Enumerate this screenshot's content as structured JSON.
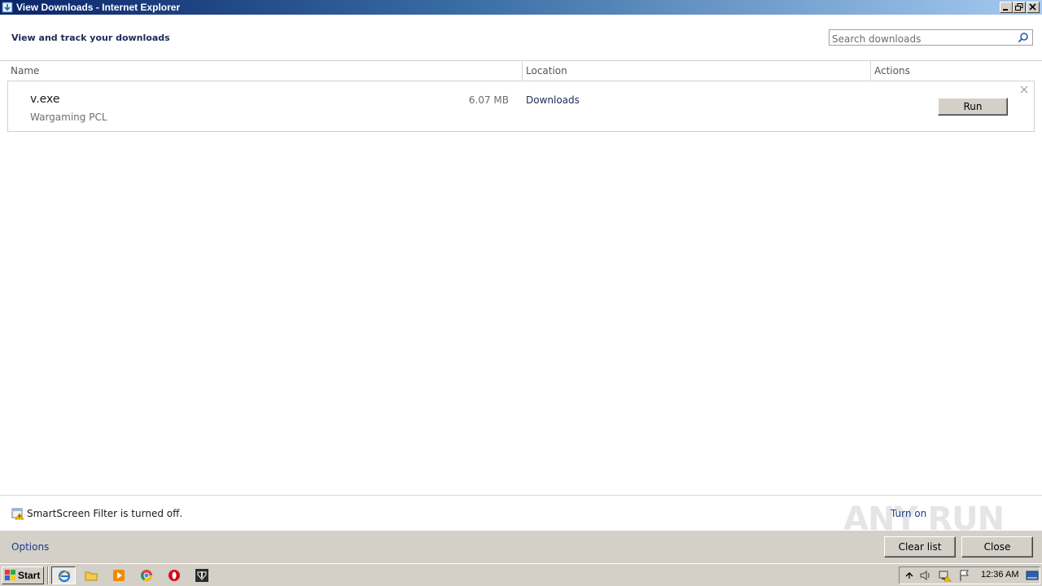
{
  "window": {
    "title": "View Downloads - Internet Explorer"
  },
  "header": {
    "title": "View and track your downloads",
    "search_placeholder": "Search downloads"
  },
  "columns": {
    "name": "Name",
    "location": "Location",
    "actions": "Actions"
  },
  "downloads": [
    {
      "file_name": "v.exe",
      "publisher": "Wargaming PCL",
      "size": "6.07 MB",
      "location": "Downloads",
      "action_label": "Run"
    }
  ],
  "smartscreen": {
    "message": "SmartScreen Filter is turned off.",
    "turn_on_label": "Turn on"
  },
  "watermark": "ANY RUN",
  "footer": {
    "options_label": "Options",
    "clear_list_label": "Clear list",
    "close_label": "Close"
  },
  "taskbar": {
    "start_label": "Start",
    "clock": "12:36 AM",
    "pinned": [
      "internet-explorer-icon",
      "explorer-folder-icon",
      "media-player-icon",
      "chrome-icon",
      "opera-icon",
      "wargaming-icon"
    ]
  }
}
